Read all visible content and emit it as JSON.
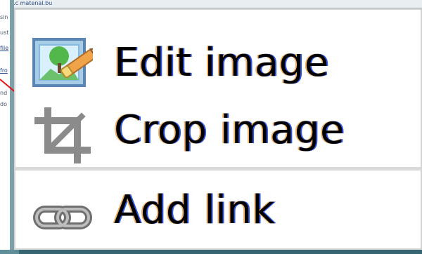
{
  "background": {
    "top_text": "gale.c matenal.bu",
    "side_snippets": [
      {
        "text": "sin",
        "link": false
      },
      {
        "text": "ust",
        "link": false
      },
      {
        "text": "file",
        "link": true
      },
      {
        "text": "fro",
        "link": true
      },
      {
        "text": "nd",
        "link": false
      },
      {
        "text": "do",
        "link": false
      }
    ],
    "annotation_color": "#e11414"
  },
  "menu": {
    "items": [
      {
        "label": "Edit image",
        "icon": "edit-image-icon"
      },
      {
        "label": "Crop image",
        "icon": "crop-icon"
      },
      {
        "label": "Add link",
        "icon": "link-icon"
      }
    ]
  }
}
